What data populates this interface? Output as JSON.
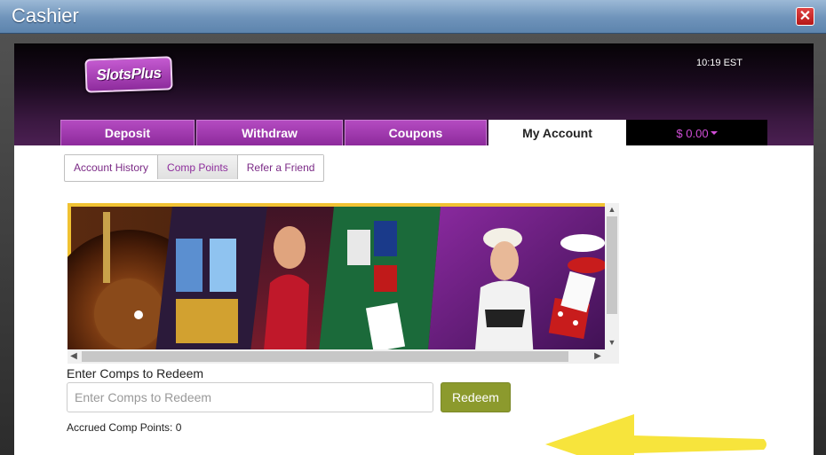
{
  "window": {
    "title": "Cashier"
  },
  "header": {
    "logo_text": "SlotsPlus",
    "time": "10:19 EST"
  },
  "tabs": [
    {
      "label": "Deposit"
    },
    {
      "label": "Withdraw"
    },
    {
      "label": "Coupons"
    },
    {
      "label": "My Account"
    }
  ],
  "balance": {
    "label": "$ 0.00"
  },
  "subtabs": [
    {
      "label": "Account History"
    },
    {
      "label": "Comp Points"
    },
    {
      "label": "Refer a Friend"
    }
  ],
  "redeem_form": {
    "label": "Enter Comps to Redeem",
    "placeholder": "Enter Comps to Redeem",
    "button_label": "Redeem",
    "accrued_label": "Accrued Comp Points: 0"
  },
  "colors": {
    "brand_purple": "#8d2a9c",
    "redeem_green": "#8c9a2d",
    "arrow_yellow": "#f7e43c"
  },
  "icons": {
    "close": "close-icon",
    "dropdown": "chevron-down-icon"
  }
}
